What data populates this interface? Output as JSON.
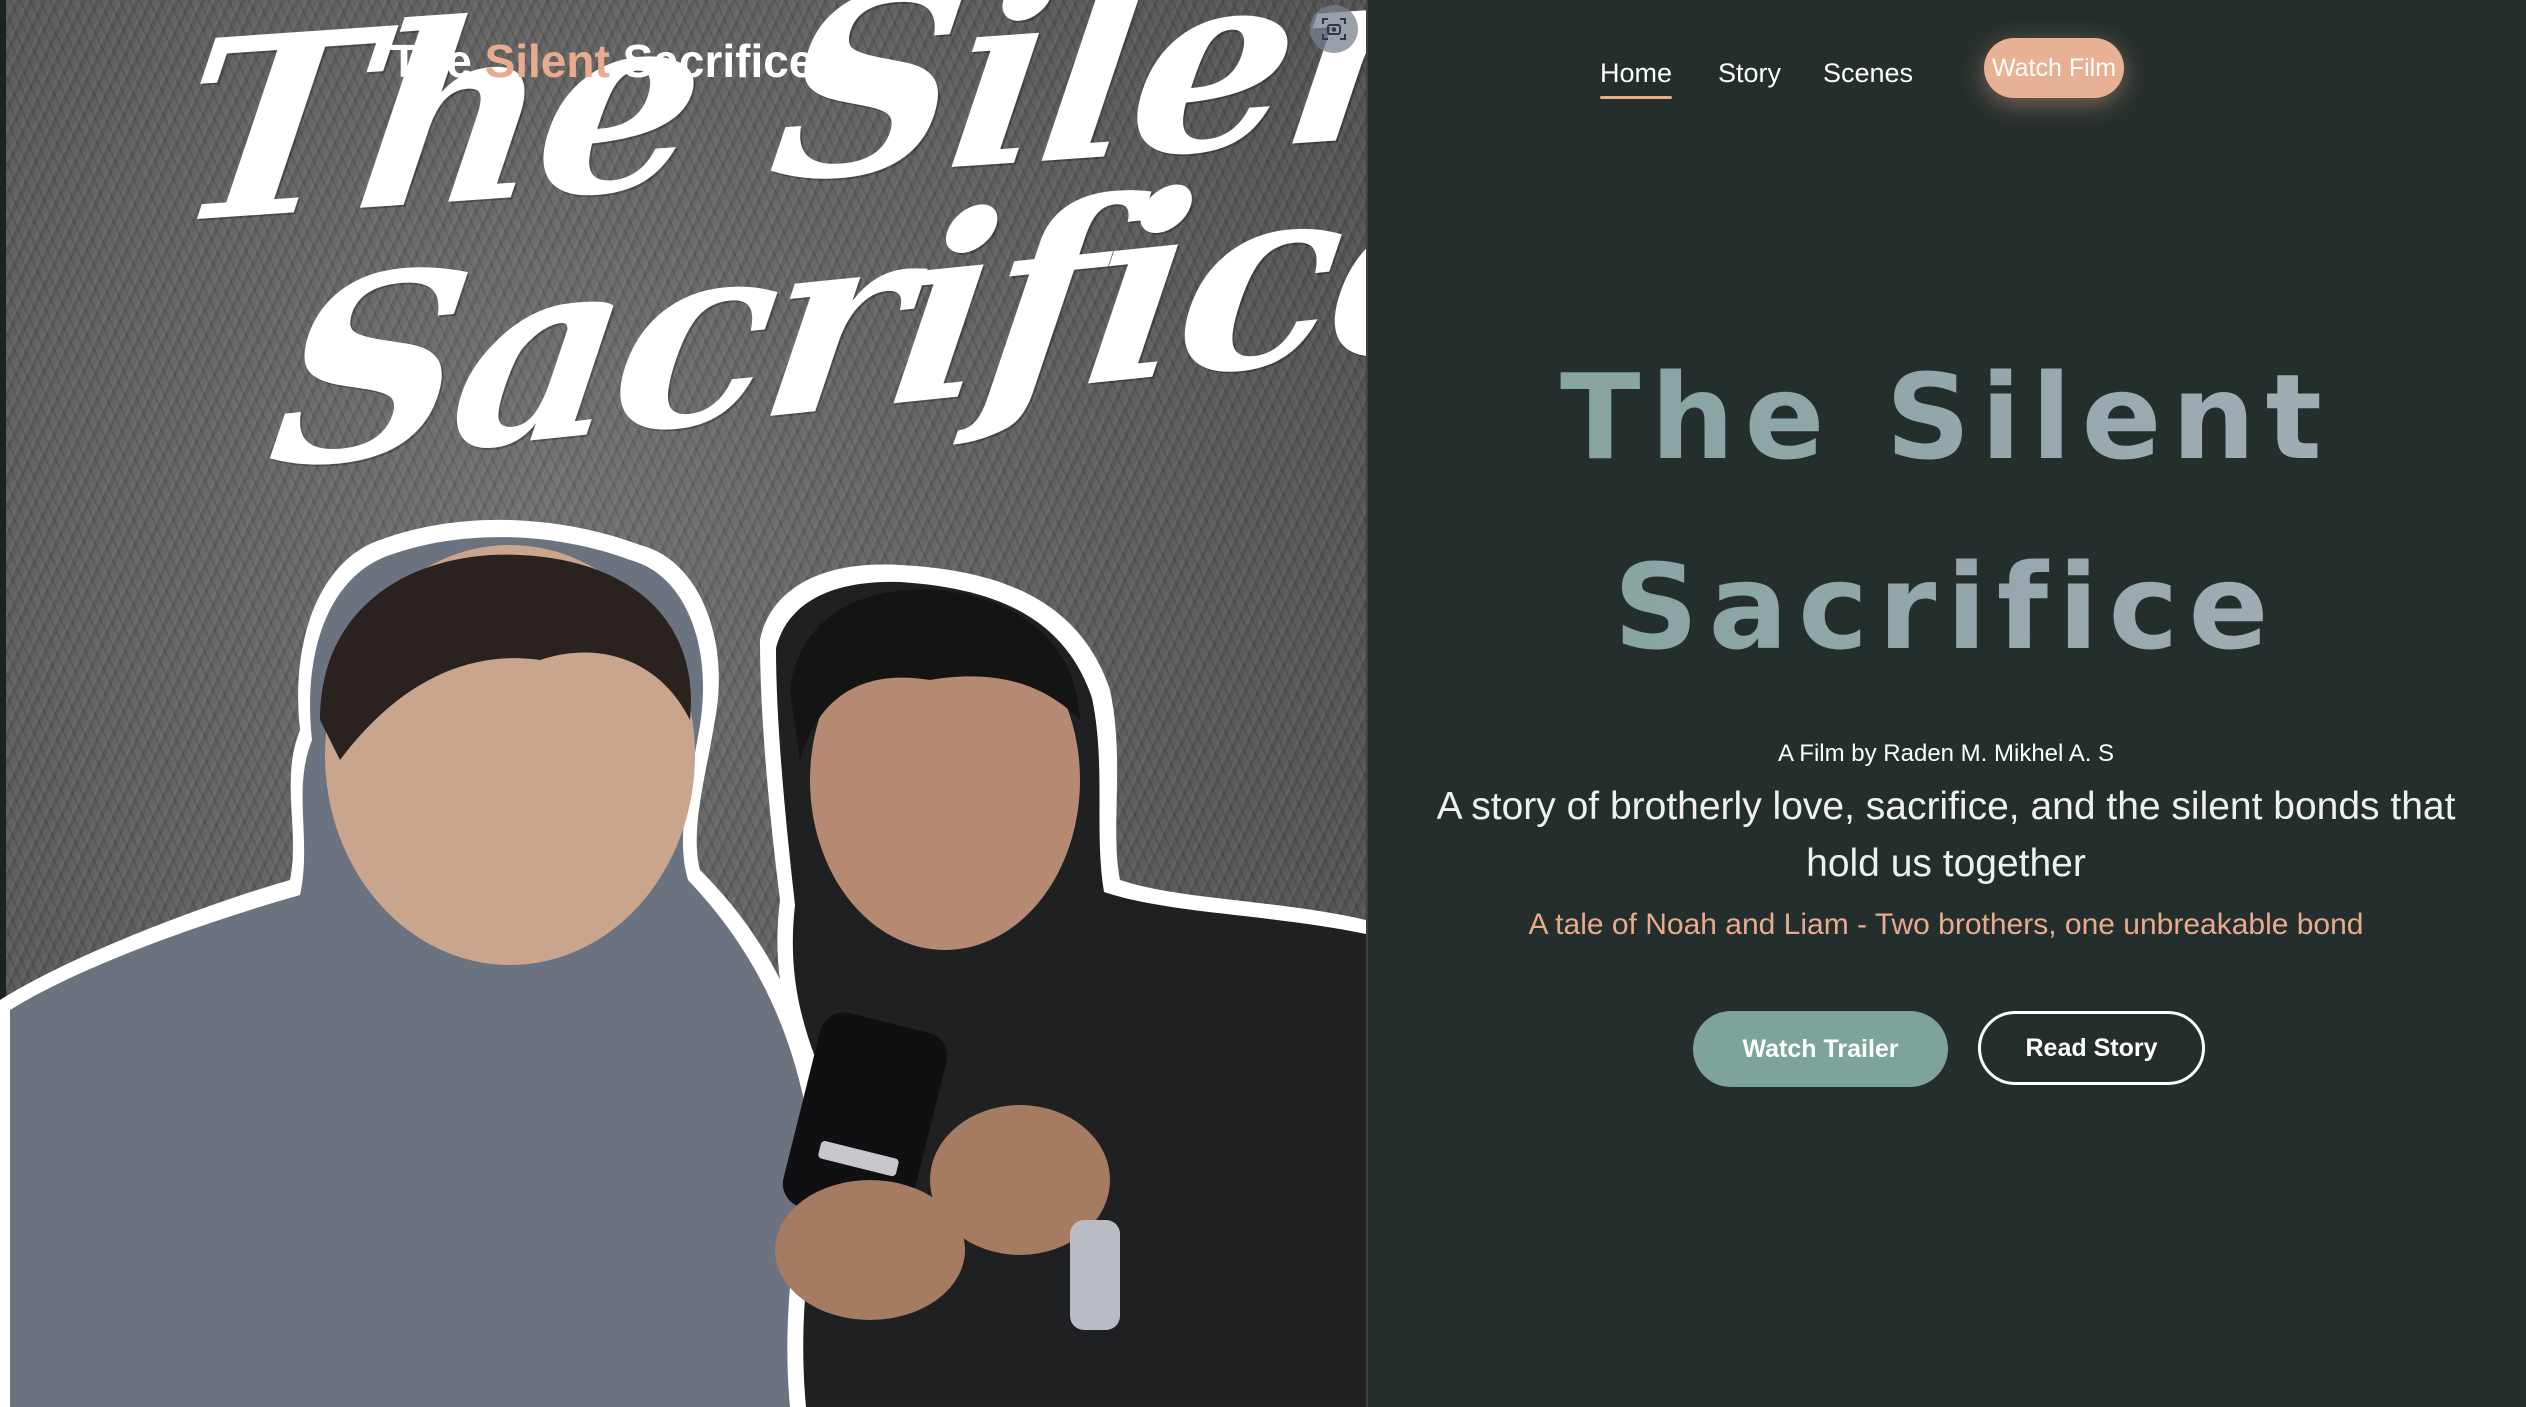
{
  "poster": {
    "script_line1": "The Silent",
    "script_line2": "Sacrifice",
    "logo_the": "The",
    "logo_silent": "Silent",
    "logo_sacrifice": "Sacrifice",
    "camera_icon": "focus-camera-icon"
  },
  "nav": {
    "home": "Home",
    "story": "Story",
    "scenes": "Scenes",
    "watch_film": "Watch Film"
  },
  "hero": {
    "title_line1": "The Silent",
    "title_line2": "Sacrifice",
    "byline": "A Film by Raden M. Mikhel A. S",
    "tagline": "A story of brotherly love, sacrifice, and the silent bonds that hold us together",
    "subtag": "A tale of Noah and Liam - Two brothers, one unbreakable bond",
    "watch_trailer": "Watch Trailer",
    "read_story": "Read Story"
  },
  "colors": {
    "background": "#242e2c",
    "accent_peach": "#e8ab8d",
    "accent_sage": "#7ea39a",
    "title_gradient_end": "#a6b0b8"
  }
}
